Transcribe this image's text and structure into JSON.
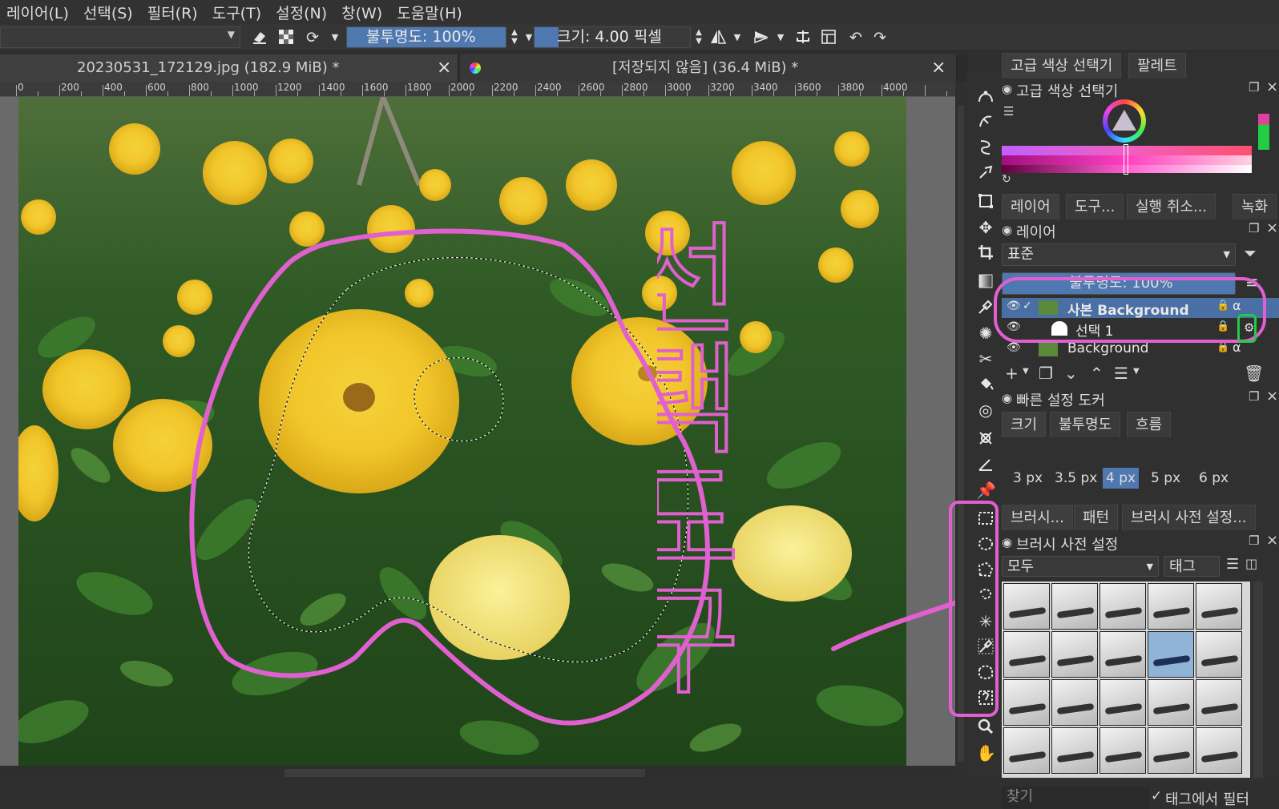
{
  "menubar": [
    "레이어(L)",
    "선택(S)",
    "필터(R)",
    "도구(T)",
    "설정(N)",
    "창(W)",
    "도움말(H)"
  ],
  "toolbar": {
    "opacity_label": "불투명도: 100%",
    "size_label": "크기: 4.00 픽셀"
  },
  "tabs": [
    {
      "title": "20230531_172129.jpg (182.9 MiB) *",
      "close": "×"
    },
    {
      "title": "[저장되지 않음]  (36.4 MiB) *",
      "close": "×"
    }
  ],
  "ruler_labels": [
    "0",
    "200",
    "400",
    "600",
    "800",
    "1000",
    "1200",
    "1400",
    "1600",
    "1800",
    "2000",
    "2200",
    "2400",
    "2600",
    "2800",
    "3000",
    "3200",
    "3400",
    "3600",
    "3800",
    "4000"
  ],
  "annotation_text": "선택도구",
  "color_docker": {
    "tabs": [
      "고급 색상 선택기",
      "팔레트"
    ],
    "title": "고급 색상 선택기"
  },
  "layers_docker": {
    "tabs": [
      "레이어",
      "도구...",
      "실행 취소...",
      "녹화"
    ],
    "title": "레이어",
    "blend_mode": "표준",
    "opacity": "불투명도:  100%",
    "layers": [
      {
        "name": "사본 Background",
        "selected": true
      },
      {
        "name": "선택 1",
        "selected": false
      },
      {
        "name": "Background",
        "selected": false
      }
    ]
  },
  "quick_settings": {
    "title": "빠른 설정 도커",
    "tabs": [
      "크기",
      "불투명도",
      "흐름"
    ],
    "sizes": [
      "3 px",
      "3.5 px",
      "4 px",
      "5 px",
      "6 px"
    ],
    "active_size": "4 px"
  },
  "brush_docker": {
    "tabs": [
      "브러시...",
      "패턴",
      "브러시 사전 설정..."
    ],
    "title": "브러시 사전 설정",
    "filter_value": "모두",
    "tag_label": "태그",
    "search_placeholder": "찾기",
    "filter_in_tag": "태그에서 필터"
  },
  "colors": {
    "accent_selection": "#4a6fa5",
    "annotation_magenta": "#e060d0",
    "annotation_green": "#22cc44"
  }
}
